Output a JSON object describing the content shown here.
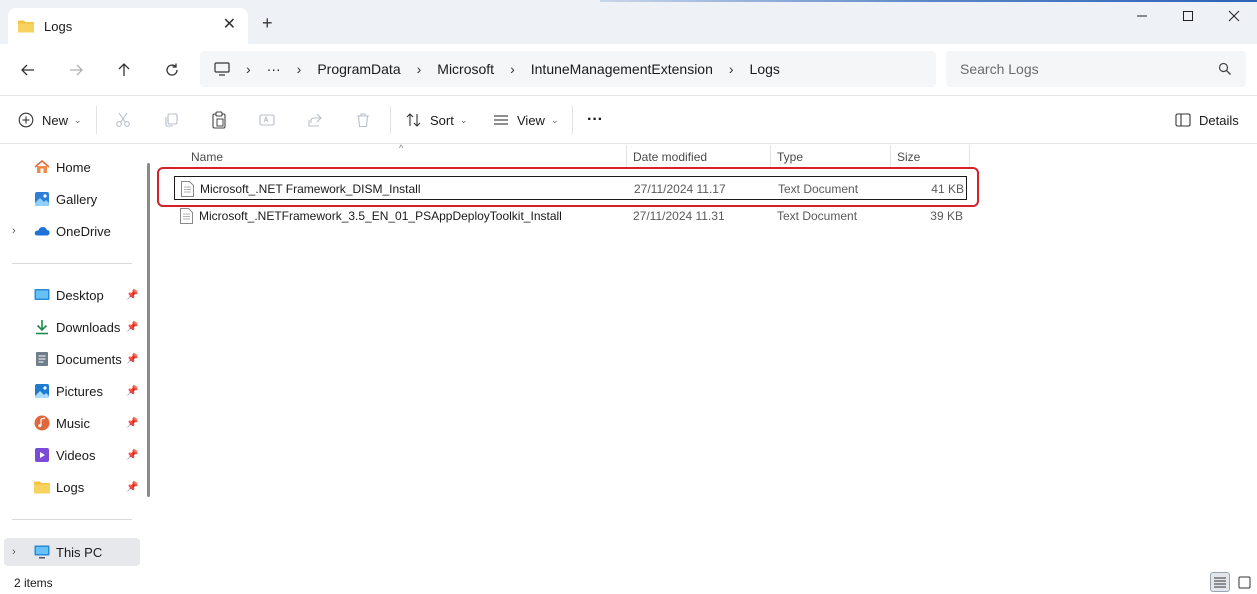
{
  "window": {
    "tab_title": "Logs",
    "new_tab_symbol": "+",
    "close_tab_symbol": "✕"
  },
  "address": {
    "breadcrumbs": [
      "ProgramData",
      "Microsoft",
      "IntuneManagementExtension",
      "Logs"
    ],
    "overflow": "···",
    "search_placeholder": "Search Logs"
  },
  "commandbar": {
    "new_label": "New",
    "sort_label": "Sort",
    "view_label": "View",
    "more_label": "···",
    "details_label": "Details"
  },
  "sidebar": {
    "items": [
      {
        "label": "Home",
        "icon": "home-icon"
      },
      {
        "label": "Gallery",
        "icon": "gallery-icon"
      },
      {
        "label": "OneDrive",
        "icon": "onedrive-icon"
      },
      {
        "label": "Desktop",
        "icon": "desktop-icon"
      },
      {
        "label": "Downloads",
        "icon": "downloads-icon"
      },
      {
        "label": "Documents",
        "icon": "documents-icon"
      },
      {
        "label": "Pictures",
        "icon": "pictures-icon"
      },
      {
        "label": "Music",
        "icon": "music-icon"
      },
      {
        "label": "Videos",
        "icon": "videos-icon"
      },
      {
        "label": "Logs",
        "icon": "folder-icon"
      },
      {
        "label": "This PC",
        "icon": "this-pc-icon"
      }
    ]
  },
  "filelist": {
    "columns": [
      "Name",
      "Date modified",
      "Type",
      "Size"
    ],
    "rows": [
      {
        "name": "Microsoft_.NET Framework_DISM_Install",
        "date": "27/11/2024 11.17",
        "type": "Text Document",
        "size": "41 KB"
      },
      {
        "name": "Microsoft_.NETFramework_3.5_EN_01_PSAppDeployToolkit_Install",
        "date": "27/11/2024 11.31",
        "type": "Text Document",
        "size": "39 KB"
      }
    ]
  },
  "status": {
    "item_count": "2 items"
  },
  "colors": {
    "highlight": "#d6202a",
    "folder": "#f3c444",
    "accent": "#2a62b8"
  }
}
